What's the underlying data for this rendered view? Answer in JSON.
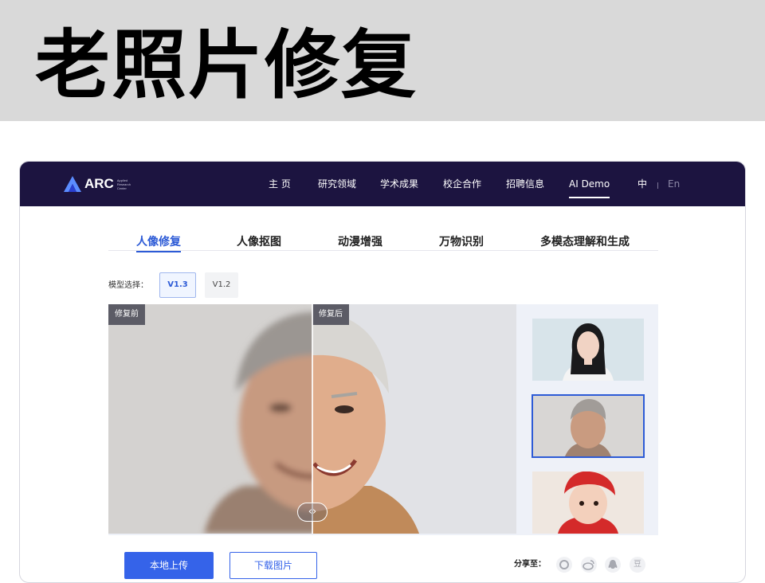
{
  "banner": {
    "title": "老照片修复"
  },
  "nav": {
    "logo_text": "ARC",
    "logo_sub": "Applied Research Center",
    "items": [
      {
        "label": "主 页"
      },
      {
        "label": "研究领域"
      },
      {
        "label": "学术成果"
      },
      {
        "label": "校企合作"
      },
      {
        "label": "招聘信息"
      },
      {
        "label": "AI Demo",
        "active": true
      }
    ],
    "lang_zh": "中",
    "lang_en": "En"
  },
  "tabs": [
    {
      "label": "人像修复",
      "active": true
    },
    {
      "label": "人像抠图"
    },
    {
      "label": "动漫增强"
    },
    {
      "label": "万物识别"
    },
    {
      "label": "多模态理解和生成"
    }
  ],
  "model": {
    "label": "模型选择：",
    "versions": [
      {
        "label": "V1.3",
        "selected": true
      },
      {
        "label": "V1.2"
      }
    ]
  },
  "viewer": {
    "before_label": "修复前",
    "after_label": "修复后",
    "handle_left": "‹",
    "handle_right": "›"
  },
  "actions": {
    "upload_label": "本地上传",
    "download_label": "下载图片",
    "share_label": "分享至：",
    "share_icons": [
      "moments-icon",
      "weibo-icon",
      "qq-icon",
      "douban-icon"
    ],
    "douban_glyph": "豆"
  },
  "colors": {
    "nav_bg": "#1c1440",
    "accent": "#3563e9",
    "banner_bg": "#d9d9d9"
  }
}
